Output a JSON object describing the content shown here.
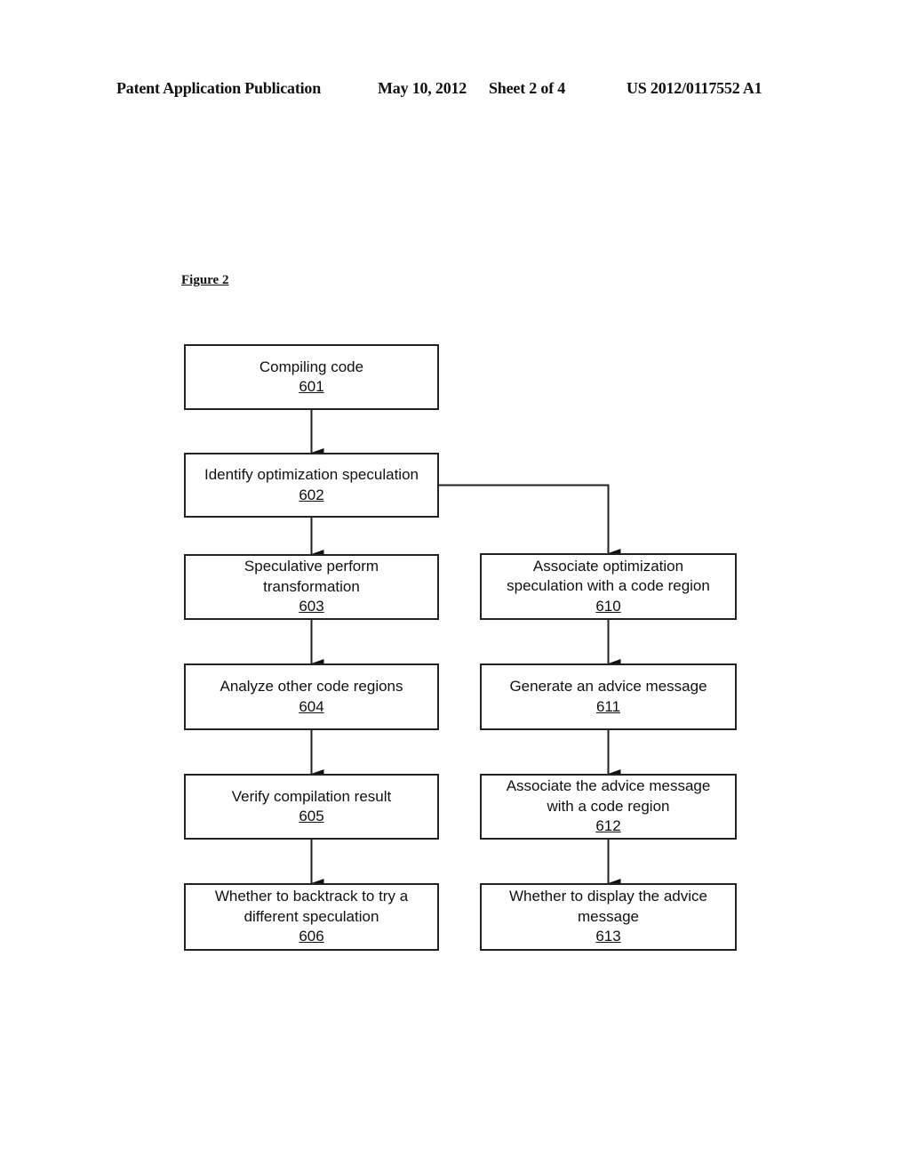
{
  "header": {
    "publication_type": "Patent Application Publication",
    "date": "May 10, 2012",
    "sheet": "Sheet 2 of 4",
    "publication_number": "US 2012/0117552 A1"
  },
  "figure": {
    "label": "Figure 2",
    "nodes": [
      {
        "id": "601",
        "lines": [
          "Compiling code"
        ],
        "ref": "601"
      },
      {
        "id": "602",
        "lines": [
          "Identify optimization speculation"
        ],
        "ref": "602"
      },
      {
        "id": "603",
        "lines": [
          "Speculative perform",
          "transformation"
        ],
        "ref": "603"
      },
      {
        "id": "604",
        "lines": [
          "Analyze other code regions"
        ],
        "ref": "604"
      },
      {
        "id": "605",
        "lines": [
          "Verify compilation result"
        ],
        "ref": "605"
      },
      {
        "id": "606",
        "lines": [
          "Whether to backtrack to try a",
          "different speculation"
        ],
        "ref": "606"
      },
      {
        "id": "610",
        "lines": [
          "Associate optimization",
          "speculation with a code region"
        ],
        "ref": "610"
      },
      {
        "id": "611",
        "lines": [
          "Generate an advice message"
        ],
        "ref": "611"
      },
      {
        "id": "612",
        "lines": [
          "Associate the advice message",
          "with a code region"
        ],
        "ref": "612"
      },
      {
        "id": "613",
        "lines": [
          "Whether to display the advice",
          "message"
        ],
        "ref": "613"
      }
    ],
    "edges": [
      {
        "from": "601",
        "to": "602"
      },
      {
        "from": "602",
        "to": "603"
      },
      {
        "from": "603",
        "to": "604"
      },
      {
        "from": "604",
        "to": "605"
      },
      {
        "from": "605",
        "to": "606"
      },
      {
        "from": "602",
        "to": "610"
      },
      {
        "from": "610",
        "to": "611"
      },
      {
        "from": "611",
        "to": "612"
      },
      {
        "from": "612",
        "to": "613"
      }
    ]
  }
}
